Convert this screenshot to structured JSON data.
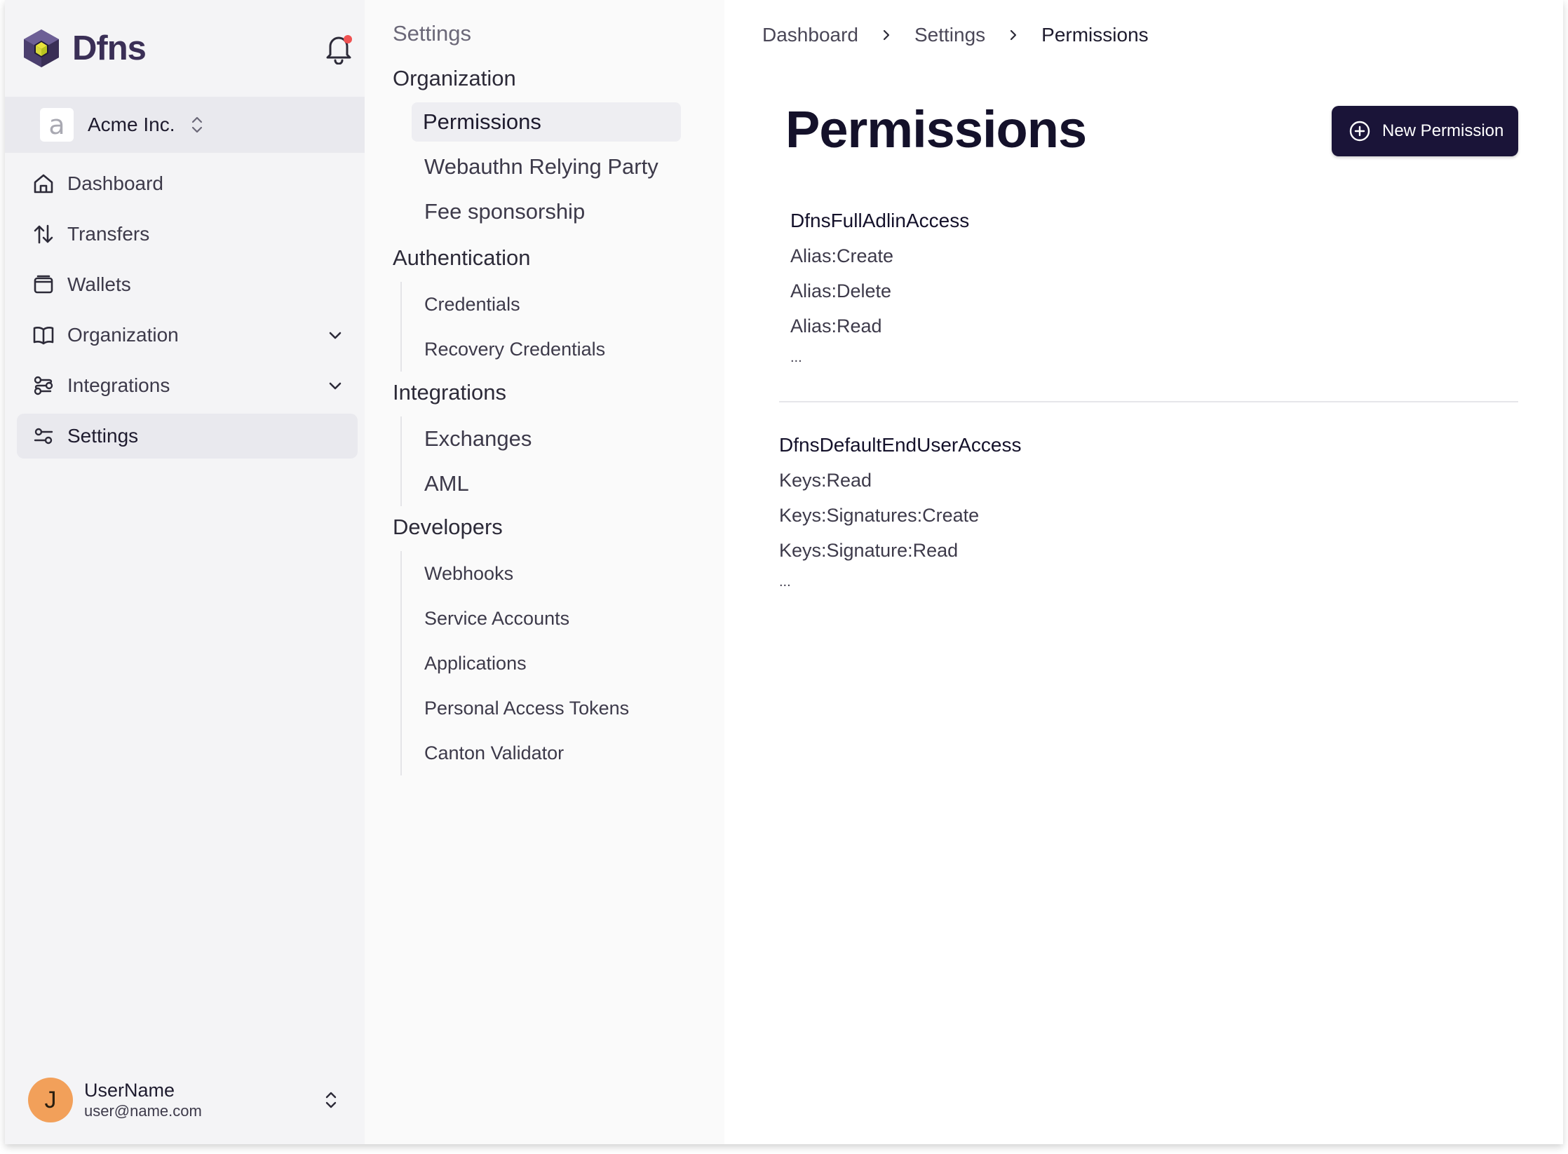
{
  "app": {
    "brand": "Dfns"
  },
  "org": {
    "avatar_letter": "a",
    "name": "Acme Inc."
  },
  "nav": [
    {
      "label": "Dashboard",
      "icon": "home-icon",
      "expandable": false,
      "active": false
    },
    {
      "label": "Transfers",
      "icon": "transfer-arrows-icon",
      "expandable": false,
      "active": false
    },
    {
      "label": "Wallets",
      "icon": "wallet-icon",
      "expandable": false,
      "active": false
    },
    {
      "label": "Organization",
      "icon": "book-icon",
      "expandable": true,
      "active": false
    },
    {
      "label": "Integrations",
      "icon": "integrations-icon",
      "expandable": true,
      "active": false
    },
    {
      "label": "Settings",
      "icon": "sliders-icon",
      "expandable": false,
      "active": true
    }
  ],
  "user": {
    "avatar_letter": "J",
    "name": "UserName",
    "email": "user@name.com"
  },
  "settings_nav": {
    "title": "Settings",
    "sections": [
      {
        "heading": "Organization",
        "items": [
          "Permissions",
          "Webauthn Relying Party",
          "Fee sponsorship"
        ],
        "selected": "Permissions"
      },
      {
        "heading": "Authentication",
        "items": [
          "Credentials",
          "Recovery Credentials"
        ]
      },
      {
        "heading": "Integrations",
        "items": [
          "Exchanges",
          "AML"
        ]
      },
      {
        "heading": "Developers",
        "items": [
          "Webhooks",
          "Service Accounts",
          "Applications",
          "Personal Access Tokens",
          "Canton Validator"
        ]
      }
    ]
  },
  "breadcrumb": [
    "Dashboard",
    "Settings",
    "Permissions"
  ],
  "main": {
    "title": "Permissions",
    "new_button_label": "New Permission",
    "permissions": [
      {
        "name": "DfnsFullAdlinAccess",
        "operations": [
          "Alias:Create",
          "Alias:Delete",
          "Alias:Read"
        ],
        "more": "..."
      },
      {
        "name": "DfnsDefaultEndUserAccess",
        "operations": [
          "Keys:Read",
          "Keys:Signatures:Create",
          "Keys:Signature:Read"
        ],
        "more": "..."
      }
    ]
  },
  "colors": {
    "accent": "#1a1438",
    "notification_dot": "#f05252",
    "user_avatar": "#f2a05a"
  }
}
